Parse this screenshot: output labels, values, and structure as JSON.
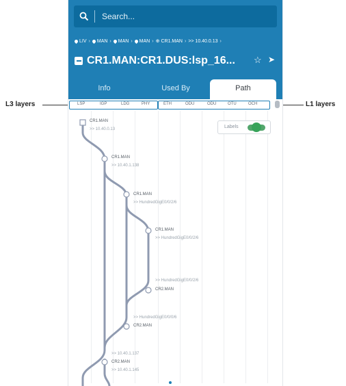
{
  "search": {
    "placeholder": "Search..."
  },
  "breadcrumb": [
    "LIV",
    "MAN",
    "MAN",
    "MAN",
    "CR1.MAN",
    ">> 10.40.0.13"
  ],
  "title": "CR1.MAN:CR1.DUS:lsp_16...",
  "icons": {
    "star": "star-icon",
    "locate": "navigate-arrow-icon",
    "search": "search-icon",
    "object": "lsp-object-icon"
  },
  "tabs": [
    {
      "label": "Info",
      "active": false
    },
    {
      "label": "Used By",
      "active": false
    },
    {
      "label": "Path",
      "active": true
    }
  ],
  "layers": {
    "l3": [
      "LSP",
      "IGP",
      "LDG",
      "PHY"
    ],
    "l1": [
      "ETH",
      "ODU",
      "ODU",
      "OTU",
      "OCH"
    ]
  },
  "labels_toggle": {
    "label": "Labels",
    "on": true
  },
  "hops": [
    {
      "name": "CR1.MAN",
      "sub": ">> 10.40.0.13"
    },
    {
      "name": "CR1.MAN",
      "sub": ">> 10.40.1.138"
    },
    {
      "name": "CR1.MAN",
      "sub": ">> HundredGigE0/0/2/6"
    },
    {
      "name": "CR1.MAN",
      "sub": ">> HundredGigE0/0/2/6"
    },
    {
      "name": "CR2.MAN",
      "sub": ">> HundredGigE0/0/2/6"
    },
    {
      "name": "CR2.MAN",
      "sub": ">> HundredGigE0/0/0/6"
    },
    {
      "name": "CR2.MAN",
      "sub": ">> 10.40.1.137"
    },
    {
      "name": "",
      "sub": ">> 10.40.1.145"
    }
  ],
  "callouts": {
    "left": "L3 layers",
    "right": "L1 layers"
  },
  "colors": {
    "header": "#1f7fb5",
    "search_bg": "#0d6b9e",
    "path_line": "#8f9ab0",
    "toggle_on": "#38a35a"
  }
}
